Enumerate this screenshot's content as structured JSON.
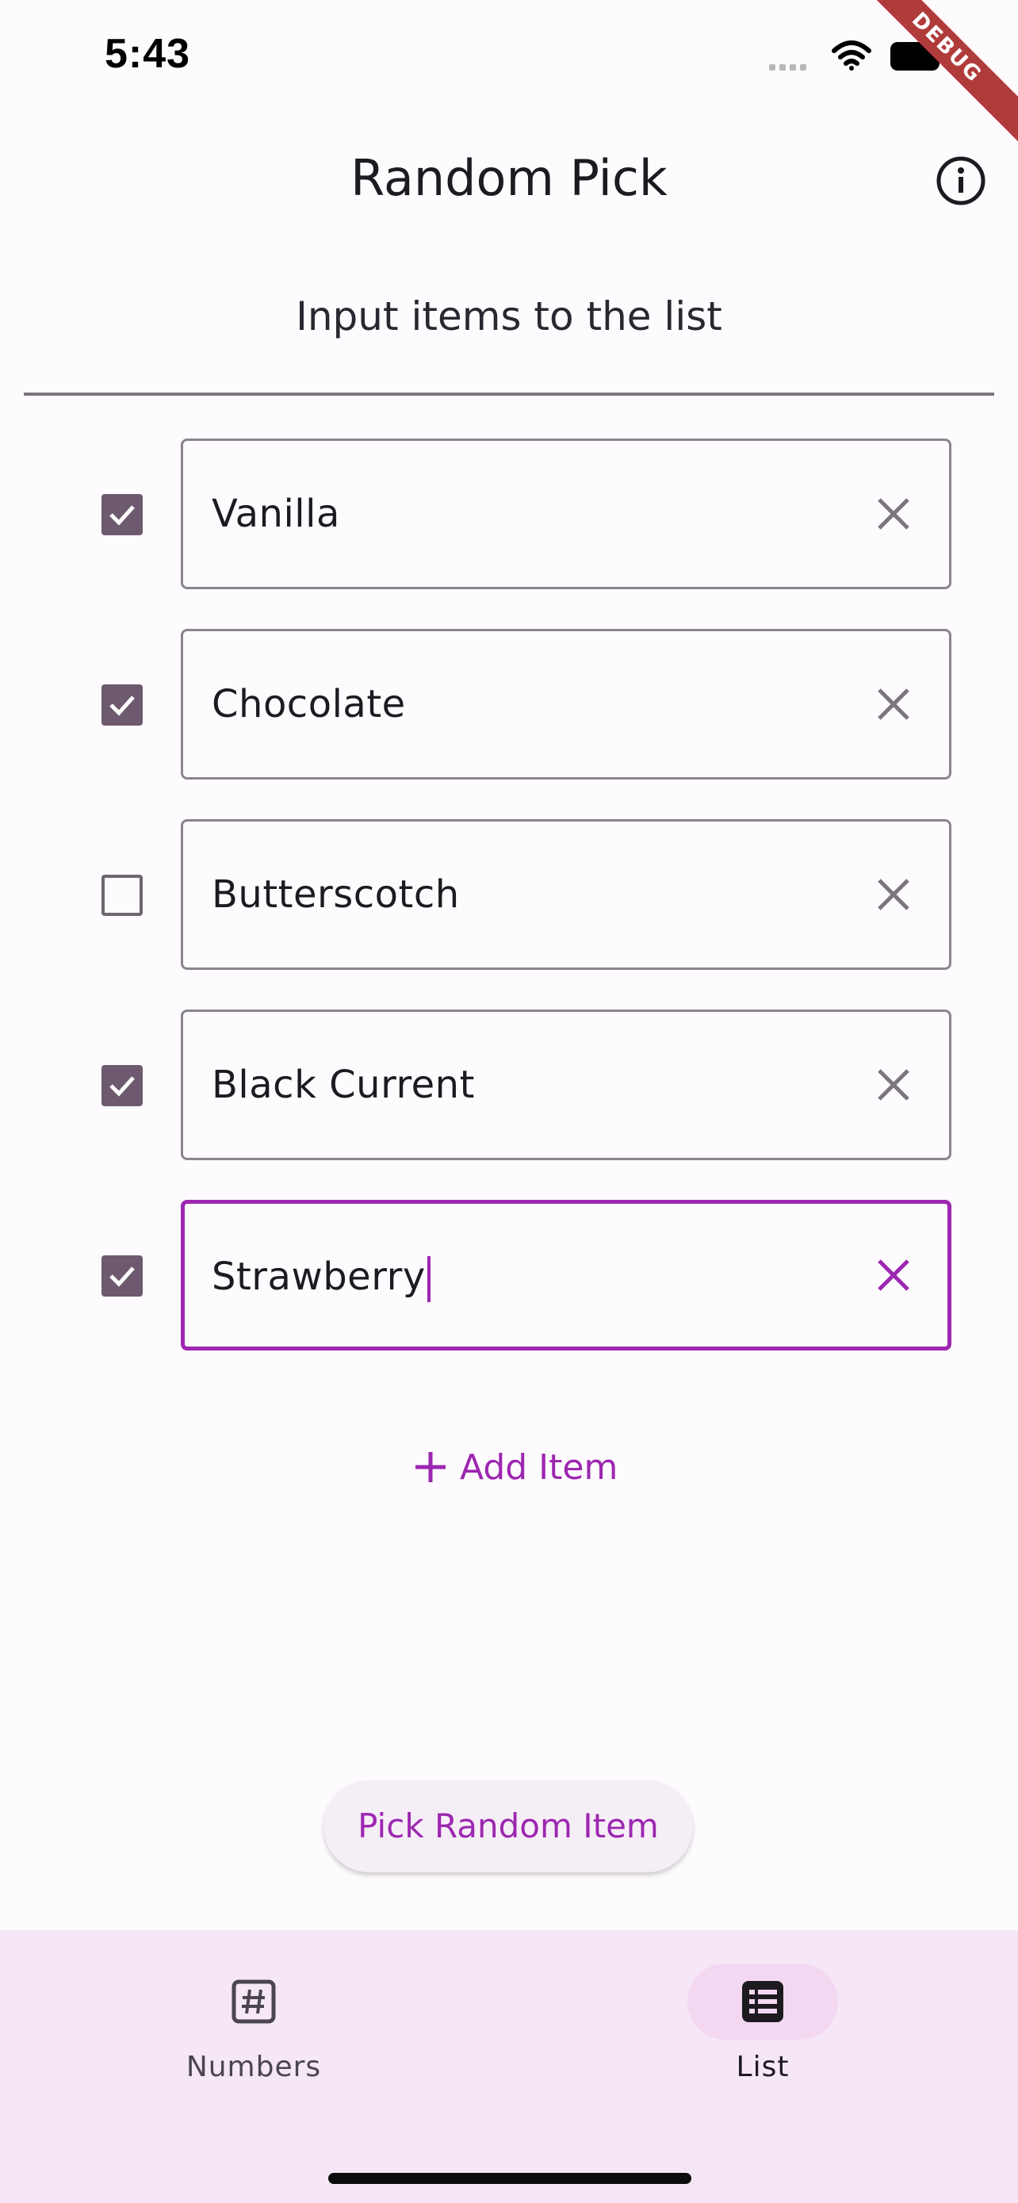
{
  "status_bar": {
    "time": "5:43"
  },
  "debug_banner": "DEBUG",
  "app_bar": {
    "title": "Random Pick"
  },
  "subtitle": "Input items to the list",
  "items": [
    {
      "label": "Vanilla",
      "checked": true
    },
    {
      "label": "Chocolate",
      "checked": true
    },
    {
      "label": "Butterscotch",
      "checked": false
    },
    {
      "label": "Black Current",
      "checked": true
    },
    {
      "label": "Strawberry",
      "checked": true,
      "focused": true
    }
  ],
  "add_item_label": "Add Item",
  "pick_button_label": "Pick Random Item",
  "bottom_nav": {
    "items": [
      {
        "label": "Numbers",
        "icon": "hash-icon",
        "active": false
      },
      {
        "label": "List",
        "icon": "list-icon",
        "active": true
      }
    ]
  },
  "colors": {
    "accent": "#9c27b0",
    "checkbox_checked": "#6e5a6e",
    "nav_background": "#f5e7f5",
    "nav_active_pill": "#f4d8f2"
  }
}
